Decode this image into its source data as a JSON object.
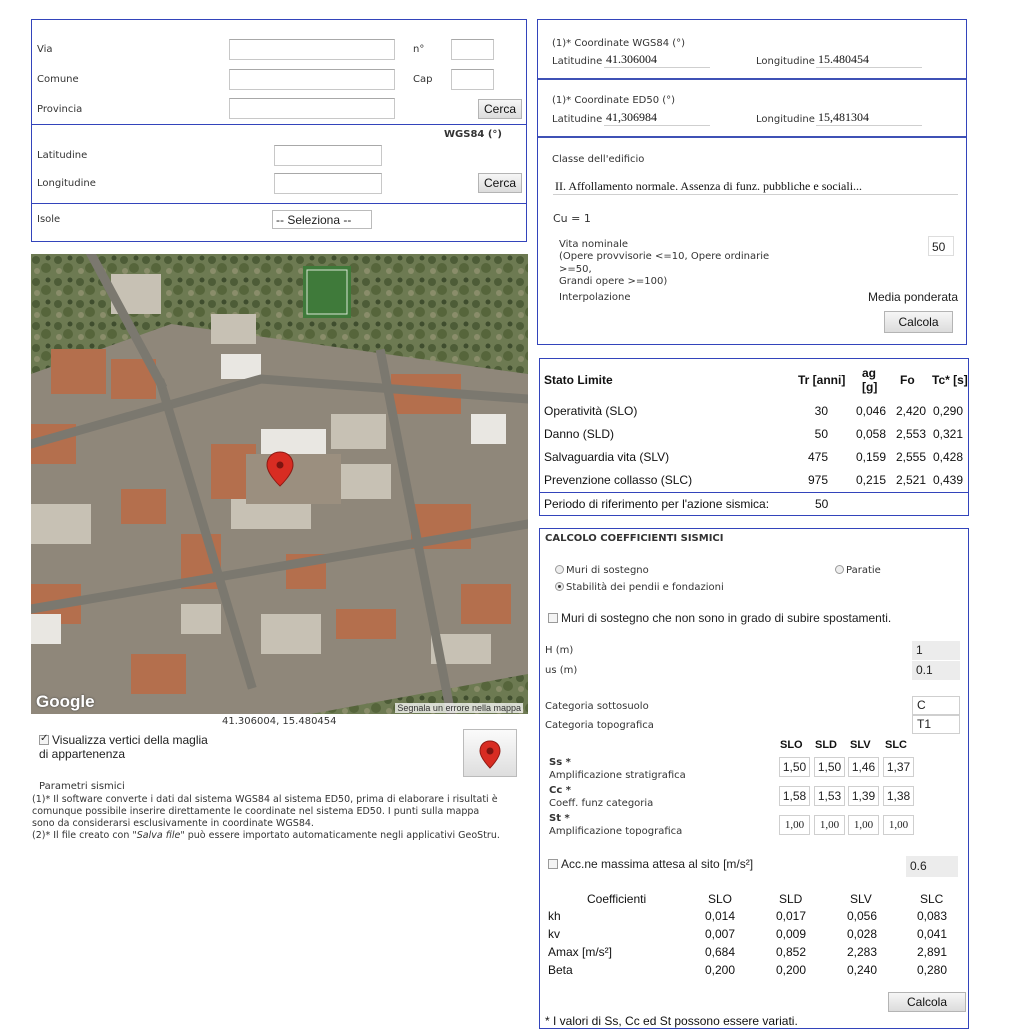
{
  "address": {
    "via_label": "Via",
    "num_label": "n°",
    "comune_label": "Comune",
    "cap_label": "Cap",
    "provincia_label": "Provincia",
    "search_button": "Cerca"
  },
  "wgs": {
    "title": "WGS84 (°)",
    "lat_label": "Latitudine",
    "lon_label": "Longitudine",
    "search_button": "Cerca"
  },
  "isole": {
    "label": "Isole",
    "select_value": "-- Seleziona --"
  },
  "coords": {
    "wgs_title": "(1)* Coordinate WGS84 (°)",
    "wgs_lat_label": "Latitudine",
    "wgs_lat": "41.306004",
    "wgs_lon_label": "Longitudine",
    "wgs_lon": "15.480454",
    "ed_title": "(1)* Coordinate ED50 (°)",
    "ed_lat_label": "Latitudine",
    "ed_lat": "41,306984",
    "ed_lon_label": "Longitudine",
    "ed_lon": "15,481304"
  },
  "building": {
    "class_label": "Classe dell'edificio",
    "class_value": "II. Affollamento normale. Assenza di funz. pubbliche e sociali...",
    "cu": "Cu = 1",
    "vita_label": "Vita nominale",
    "vita_desc1": "(Opere provvisorie <=10, Opere ordinarie",
    "vita_desc2": ">=50,",
    "vita_desc3": "Grandi opere >=100)",
    "vita_value": "50",
    "interp_label": "Interpolazione",
    "interp_value": "Media ponderata",
    "calc_button": "Calcola"
  },
  "map": {
    "google": "Google",
    "report": "Segnala un errore nella mappa",
    "coords_caption": "41.306004, 15.480454",
    "show_vertices": "Visualizza vertici della maglia",
    "show_vertices2": "di appartenenza",
    "show_vertices_checked": true
  },
  "notes": {
    "title": "Parametri sismici",
    "line1": "(1)* Il software converte i dati dal sistema WGS84 al sistema ED50, prima di elaborare i risultati è",
    "line2": "comunque possibile inserire direttamente le coordinate nel sistema ED50. I punti sulla mappa",
    "line3": "sono da considerarsi esclusivamente in coordinate WGS84.",
    "line4_a": "(2)* Il file creato con ",
    "line4_b": "\"Salva file\"",
    "line4_c": " può essere importato automaticamente negli applicativi GeoStru."
  },
  "stato": {
    "headers": [
      "Stato Limite",
      "Tr [anni]",
      "ag",
      "[g]",
      "Fo",
      "Tc* [s]"
    ],
    "rows": [
      {
        "name": "Operatività (SLO)",
        "tr": "30",
        "ag": "0,046",
        "fo": "2,420",
        "tc": "0,290"
      },
      {
        "name": "Danno (SLD)",
        "tr": "50",
        "ag": "0,058",
        "fo": "2,553",
        "tc": "0,321"
      },
      {
        "name": "Salvaguardia vita (SLV)",
        "tr": "475",
        "ag": "0,159",
        "fo": "2,555",
        "tc": "0,428"
      },
      {
        "name": "Prevenzione collasso (SLC)",
        "tr": "975",
        "ag": "0,215",
        "fo": "2,521",
        "tc": "0,439"
      }
    ],
    "periodo_label": "Periodo di riferimento per l'azione sismica:",
    "periodo_value": "50"
  },
  "coeff": {
    "title": "CALCOLO COEFFICIENTI SISMICI",
    "radio_muri": "Muri di sostegno",
    "radio_paratie": "Paratie",
    "radio_stabilita": "Stabilità dei pendii e fondazioni",
    "chk_muri": "Muri di sostegno che non sono in grado di subire spostamenti.",
    "h_label": "H (m)",
    "h_value": "1",
    "us_label": "us (m)",
    "us_value": "0.1",
    "cat_sott_label": "Categoria sottosuolo",
    "cat_sott_value": "C",
    "cat_topo_label": "Categoria topografica",
    "cat_topo_value": "T1",
    "cols": [
      "SLO",
      "SLD",
      "SLV",
      "SLC"
    ],
    "ss_label": "Ss *",
    "ss_desc": "Amplificazione stratigrafica",
    "ss_values": [
      "1,50",
      "1,50",
      "1,46",
      "1,37"
    ],
    "cc_label": "Cc *",
    "cc_desc": "Coeff. funz categoria",
    "cc_values": [
      "1,58",
      "1,53",
      "1,39",
      "1,38"
    ],
    "st_label": "St *",
    "st_desc": "Amplificazione topografica",
    "st_values": [
      "1,00",
      "1,00",
      "1,00",
      "1,00"
    ],
    "acc_label": "Acc.ne massima attesa al sito [m/s²]",
    "acc_value": "0.6",
    "res_headers": [
      "Coefficienti",
      "SLO",
      "SLD",
      "SLV",
      "SLC"
    ],
    "res_rows": [
      {
        "name": "kh",
        "v": [
          "0,014",
          "0,017",
          "0,056",
          "0,083"
        ]
      },
      {
        "name": "kv",
        "v": [
          "0,007",
          "0,009",
          "0,028",
          "0,041"
        ]
      },
      {
        "name": "Amax [m/s²]",
        "v": [
          "0,684",
          "0,852",
          "2,283",
          "2,891"
        ]
      },
      {
        "name": "Beta",
        "v": [
          "0,200",
          "0,200",
          "0,240",
          "0,280"
        ]
      }
    ],
    "calc_button": "Calcola",
    "footnote": "* I valori di Ss, Cc ed St possono essere variati."
  }
}
